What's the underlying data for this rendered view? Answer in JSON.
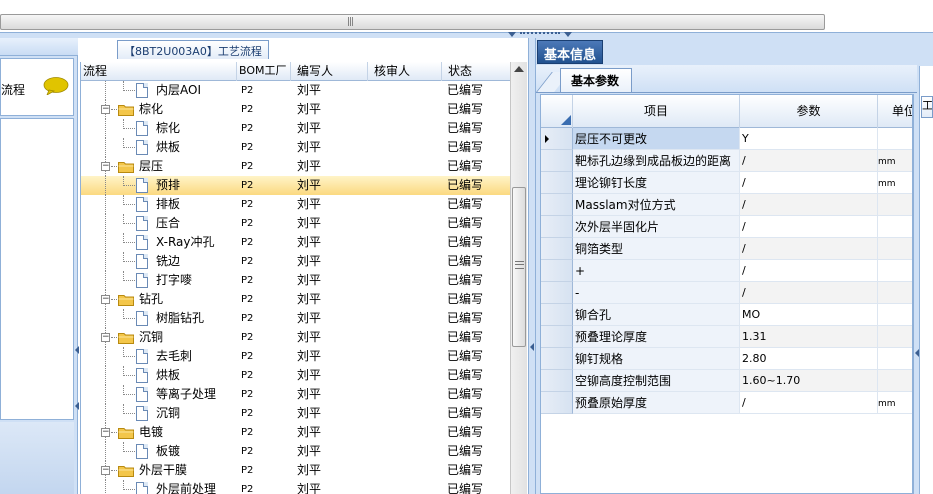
{
  "left_panel": {
    "label": "流程",
    "chat_icon": "speech-bubble-icon"
  },
  "process_tab": {
    "label": "【8BT2U003A0】工艺流程"
  },
  "tree_grid": {
    "columns": [
      "流程",
      "BOM工厂",
      "编写人",
      "核审人",
      "状态"
    ],
    "rows": [
      {
        "level": 2,
        "type": "doc",
        "label": "内层AOI",
        "bom": "P2",
        "author": "刘平",
        "reviewer": "",
        "status": "已编写"
      },
      {
        "level": 1,
        "type": "folder",
        "label": "棕化",
        "bom": "P2",
        "author": "刘平",
        "reviewer": "",
        "status": "已编写"
      },
      {
        "level": 2,
        "type": "doc",
        "label": "棕化",
        "bom": "P2",
        "author": "刘平",
        "reviewer": "",
        "status": "已编写"
      },
      {
        "level": 2,
        "type": "doc",
        "label": "烘板",
        "bom": "P2",
        "author": "刘平",
        "reviewer": "",
        "status": "已编写"
      },
      {
        "level": 1,
        "type": "folder",
        "label": "层压",
        "bom": "P2",
        "author": "刘平",
        "reviewer": "",
        "status": "已编写"
      },
      {
        "level": 2,
        "type": "doc",
        "label": "预排",
        "bom": "P2",
        "author": "刘平",
        "reviewer": "",
        "status": "已编写",
        "selected": true
      },
      {
        "level": 2,
        "type": "doc",
        "label": "排板",
        "bom": "P2",
        "author": "刘平",
        "reviewer": "",
        "status": "已编写"
      },
      {
        "level": 2,
        "type": "doc",
        "label": "压合",
        "bom": "P2",
        "author": "刘平",
        "reviewer": "",
        "status": "已编写"
      },
      {
        "level": 2,
        "type": "doc",
        "label": "X-Ray冲孔",
        "bom": "P2",
        "author": "刘平",
        "reviewer": "",
        "status": "已编写"
      },
      {
        "level": 2,
        "type": "doc",
        "label": "铣边",
        "bom": "P2",
        "author": "刘平",
        "reviewer": "",
        "status": "已编写"
      },
      {
        "level": 2,
        "type": "doc",
        "label": "打字嘜",
        "bom": "P2",
        "author": "刘平",
        "reviewer": "",
        "status": "已编写"
      },
      {
        "level": 1,
        "type": "folder",
        "label": "钻孔",
        "bom": "P2",
        "author": "刘平",
        "reviewer": "",
        "status": "已编写"
      },
      {
        "level": 2,
        "type": "doc",
        "label": "树脂钻孔",
        "bom": "P2",
        "author": "刘平",
        "reviewer": "",
        "status": "已编写"
      },
      {
        "level": 1,
        "type": "folder",
        "label": "沉铜",
        "bom": "P2",
        "author": "刘平",
        "reviewer": "",
        "status": "已编写"
      },
      {
        "level": 2,
        "type": "doc",
        "label": "去毛刺",
        "bom": "P2",
        "author": "刘平",
        "reviewer": "",
        "status": "已编写"
      },
      {
        "level": 2,
        "type": "doc",
        "label": "烘板",
        "bom": "P2",
        "author": "刘平",
        "reviewer": "",
        "status": "已编写"
      },
      {
        "level": 2,
        "type": "doc",
        "label": "等离子处理",
        "bom": "P2",
        "author": "刘平",
        "reviewer": "",
        "status": "已编写"
      },
      {
        "level": 2,
        "type": "doc",
        "label": "沉铜",
        "bom": "P2",
        "author": "刘平",
        "reviewer": "",
        "status": "已编写"
      },
      {
        "level": 1,
        "type": "folder",
        "label": "电镀",
        "bom": "P2",
        "author": "刘平",
        "reviewer": "",
        "status": "已编写"
      },
      {
        "level": 2,
        "type": "doc",
        "label": "板镀",
        "bom": "P2",
        "author": "刘平",
        "reviewer": "",
        "status": "已编写"
      },
      {
        "level": 1,
        "type": "folder",
        "label": "外层干膜",
        "bom": "P2",
        "author": "刘平",
        "reviewer": "",
        "status": "已编写"
      },
      {
        "level": 2,
        "type": "doc",
        "label": "外层前处理",
        "bom": "P2",
        "author": "刘平",
        "reviewer": "",
        "status": "已编写"
      }
    ]
  },
  "right_panel": {
    "info_tab": "基本信息",
    "params_tab": "基本参数",
    "edge_tab": "工",
    "columns": [
      "项目",
      "参数",
      "单位"
    ],
    "rows": [
      {
        "item": "层压不可更改",
        "value": "Y",
        "unit": "",
        "current": true
      },
      {
        "item": "靶标孔边缘到成品板边的距离",
        "value": "/",
        "unit": "mm"
      },
      {
        "item": "理论铆钉长度",
        "value": "/",
        "unit": "mm"
      },
      {
        "item": "Masslam对位方式",
        "value": "/",
        "unit": ""
      },
      {
        "item": "次外层半固化片",
        "value": "/",
        "unit": ""
      },
      {
        "item": "铜箔类型",
        "value": "/",
        "unit": ""
      },
      {
        "item": "+",
        "value": "/",
        "unit": ""
      },
      {
        "item": "-",
        "value": "/",
        "unit": ""
      },
      {
        "item": "铆合孔",
        "value": "MO",
        "unit": ""
      },
      {
        "item": "预叠理论厚度",
        "value": "1.31",
        "unit": ""
      },
      {
        "item": "铆钉规格",
        "value": "2.80",
        "unit": ""
      },
      {
        "item": "空铆高度控制范围",
        "value": "1.60~1.70",
        "unit": ""
      },
      {
        "item": "预叠原始厚度",
        "value": "/",
        "unit": "mm"
      }
    ]
  },
  "colors": {
    "panel_bg": "#cfe0f5",
    "border": "#8fb0d8",
    "selected_row": "#fbd980",
    "info_tab_bg": "#21518f"
  }
}
